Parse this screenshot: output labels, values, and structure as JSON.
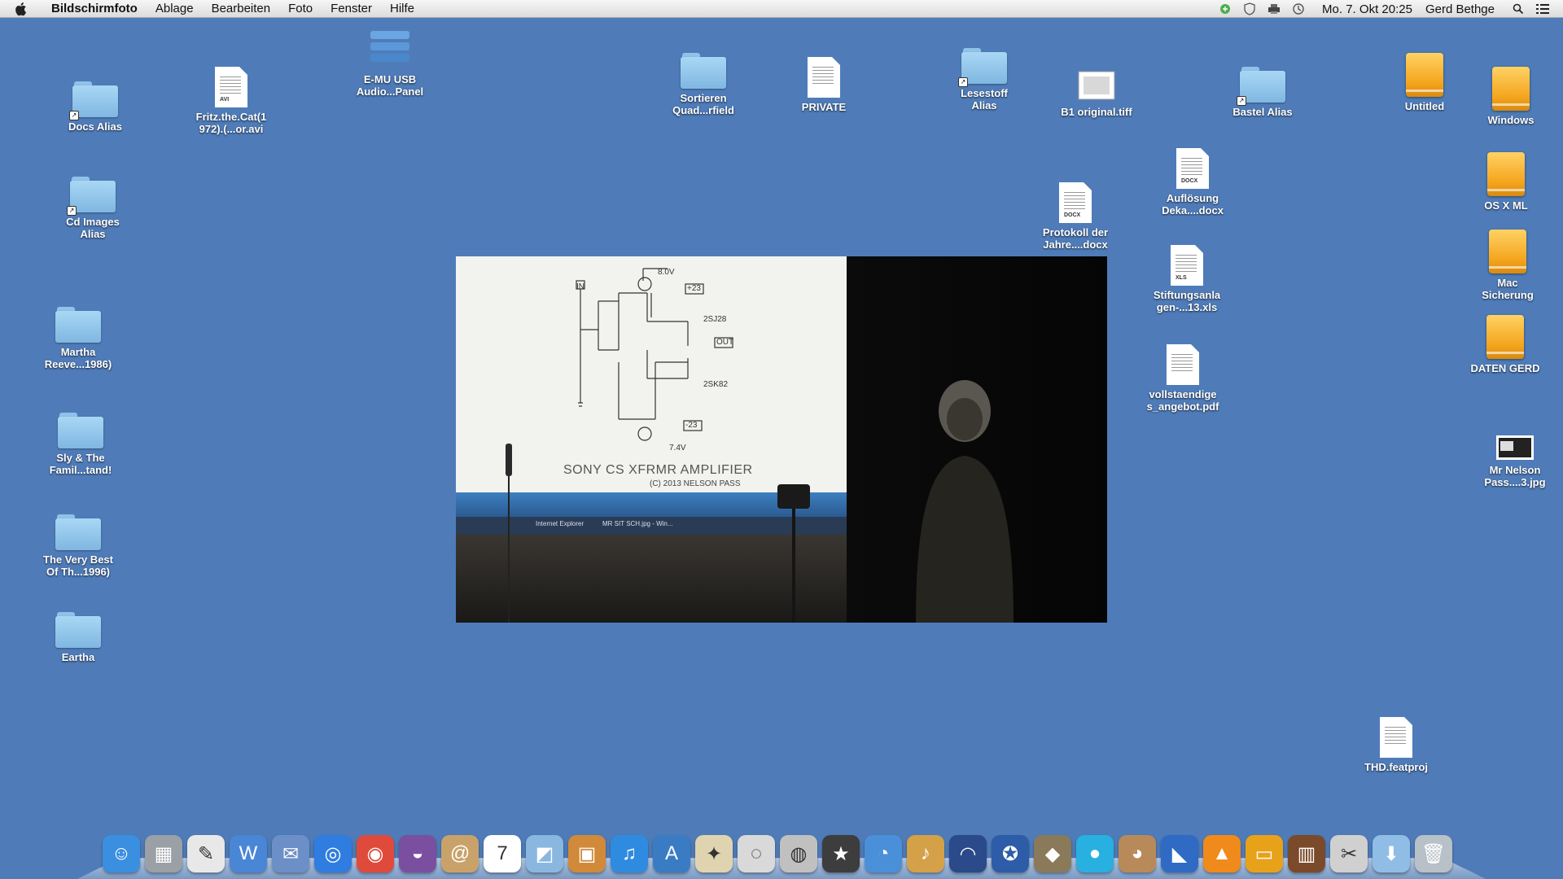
{
  "menubar": {
    "app_name": "Bildschirmfoto",
    "items": [
      "Ablage",
      "Bearbeiten",
      "Foto",
      "Fenster",
      "Hilfe"
    ],
    "clock": "Mo. 7. Okt  20:25",
    "user": "Gerd Bethge"
  },
  "desktop": {
    "icons": [
      {
        "label": "Docs Alias",
        "kind": "folder-alias"
      },
      {
        "label": "Fritz.the.Cat(1\n972).(...or.avi",
        "kind": "avi"
      },
      {
        "label": "E-MU USB\nAudio...Panel",
        "kind": "app"
      },
      {
        "label": "Sortieren\nQuad...rfield",
        "kind": "folder"
      },
      {
        "label": "PRIVATE",
        "kind": "image-doc"
      },
      {
        "label": "Lesestoff\nAlias",
        "kind": "folder-alias"
      },
      {
        "label": "B1 original.tiff",
        "kind": "tiff"
      },
      {
        "label": "Bastel Alias",
        "kind": "folder-alias"
      },
      {
        "label": "Untitled",
        "kind": "drive"
      },
      {
        "label": "Windows",
        "kind": "drive"
      },
      {
        "label": "Cd Images\nAlias",
        "kind": "folder-alias"
      },
      {
        "label": "Auflösung\nDeka....docx",
        "kind": "docx"
      },
      {
        "label": "Protokoll der\nJahre....docx",
        "kind": "docx"
      },
      {
        "label": "OS X ML",
        "kind": "drive"
      },
      {
        "label": "Mac\nSicherung",
        "kind": "drive"
      },
      {
        "label": "Stiftungsanla\ngen-...13.xls",
        "kind": "xls"
      },
      {
        "label": "Martha\nReeve...1986)",
        "kind": "folder"
      },
      {
        "label": "DATEN GERD",
        "kind": "drive"
      },
      {
        "label": "vollstaendige\ns_angebot.pdf",
        "kind": "pdf"
      },
      {
        "label": "Sly & The\nFamil...tand!",
        "kind": "folder"
      },
      {
        "label": "Mr Nelson\nPass....3.jpg",
        "kind": "jpg"
      },
      {
        "label": "The Very Best\nOf Th...1996)",
        "kind": "folder"
      },
      {
        "label": "Eartha",
        "kind": "folder"
      },
      {
        "label": "THD.featproj",
        "kind": "featproj"
      }
    ]
  },
  "video": {
    "schematic_title": "SONY CS XFRMR AMPLIFIER",
    "schematic_copyright": "(C) 2013 NELSON PASS",
    "labels": [
      "IN",
      "8.0V",
      "+23",
      "2SJ28",
      "OUT",
      "2SK82",
      "-23",
      "7.4V"
    ],
    "taskbar_items": [
      "Internet Explorer",
      "MR SIT SCH.jpg - Win..."
    ]
  },
  "dock": {
    "items": [
      {
        "name": "finder",
        "color": "#3b8fe0",
        "glyph": "☺"
      },
      {
        "name": "calculator",
        "color": "#9aa0a6",
        "glyph": "▦"
      },
      {
        "name": "textedit",
        "color": "#e8e8e8",
        "glyph": "✎"
      },
      {
        "name": "word",
        "color": "#4a86d6",
        "glyph": "W"
      },
      {
        "name": "mail-stamp",
        "color": "#6d8fc7",
        "glyph": "✉"
      },
      {
        "name": "safari",
        "color": "#2f7de0",
        "glyph": "◎"
      },
      {
        "name": "chrome",
        "color": "#e04a3b",
        "glyph": "◉"
      },
      {
        "name": "tor",
        "color": "#7b4fa0",
        "glyph": "◒"
      },
      {
        "name": "address-book",
        "color": "#c9a26a",
        "glyph": "@"
      },
      {
        "name": "ical",
        "color": "#ffffff",
        "glyph": "7"
      },
      {
        "name": "preview",
        "color": "#8ab7e0",
        "glyph": "◩"
      },
      {
        "name": "iphoto",
        "color": "#d08a3a",
        "glyph": "▣"
      },
      {
        "name": "itunes",
        "color": "#2f8be0",
        "glyph": "♫"
      },
      {
        "name": "app-store",
        "color": "#3a7cc4",
        "glyph": "A"
      },
      {
        "name": "pixelmator",
        "color": "#e0d4b0",
        "glyph": "✦"
      },
      {
        "name": "dvd-max",
        "color": "#d9d9d9",
        "glyph": "◌"
      },
      {
        "name": "dvd-player",
        "color": "#c0c0c0",
        "glyph": "◍"
      },
      {
        "name": "imovie",
        "color": "#3d3d3d",
        "glyph": "★"
      },
      {
        "name": "idvd",
        "color": "#4a90d9",
        "glyph": "◔"
      },
      {
        "name": "garageband",
        "color": "#d4a048",
        "glyph": "♪"
      },
      {
        "name": "audio-app",
        "color": "#2a4a8a",
        "glyph": "◠"
      },
      {
        "name": "network-app",
        "color": "#2d5ca8",
        "glyph": "✪"
      },
      {
        "name": "gimp",
        "color": "#8a7a5a",
        "glyph": "◆"
      },
      {
        "name": "circle-app",
        "color": "#27b0e0",
        "glyph": "●"
      },
      {
        "name": "adium",
        "color": "#b88a5a",
        "glyph": "◕"
      },
      {
        "name": "cyberduck",
        "color": "#2f6bc4",
        "glyph": "◣"
      },
      {
        "name": "vlc",
        "color": "#f08a1a",
        "glyph": "▲"
      },
      {
        "name": "tv-app",
        "color": "#e8a21a",
        "glyph": "▭"
      },
      {
        "name": "books",
        "color": "#7a4a2a",
        "glyph": "▥"
      },
      {
        "name": "scissors",
        "color": "#d0d0d0",
        "glyph": "✂"
      },
      {
        "name": "downloads-folder",
        "color": "#8fbde6",
        "glyph": "⬇"
      },
      {
        "name": "trash",
        "color": "#b8c0c8",
        "glyph": "🗑"
      }
    ]
  }
}
